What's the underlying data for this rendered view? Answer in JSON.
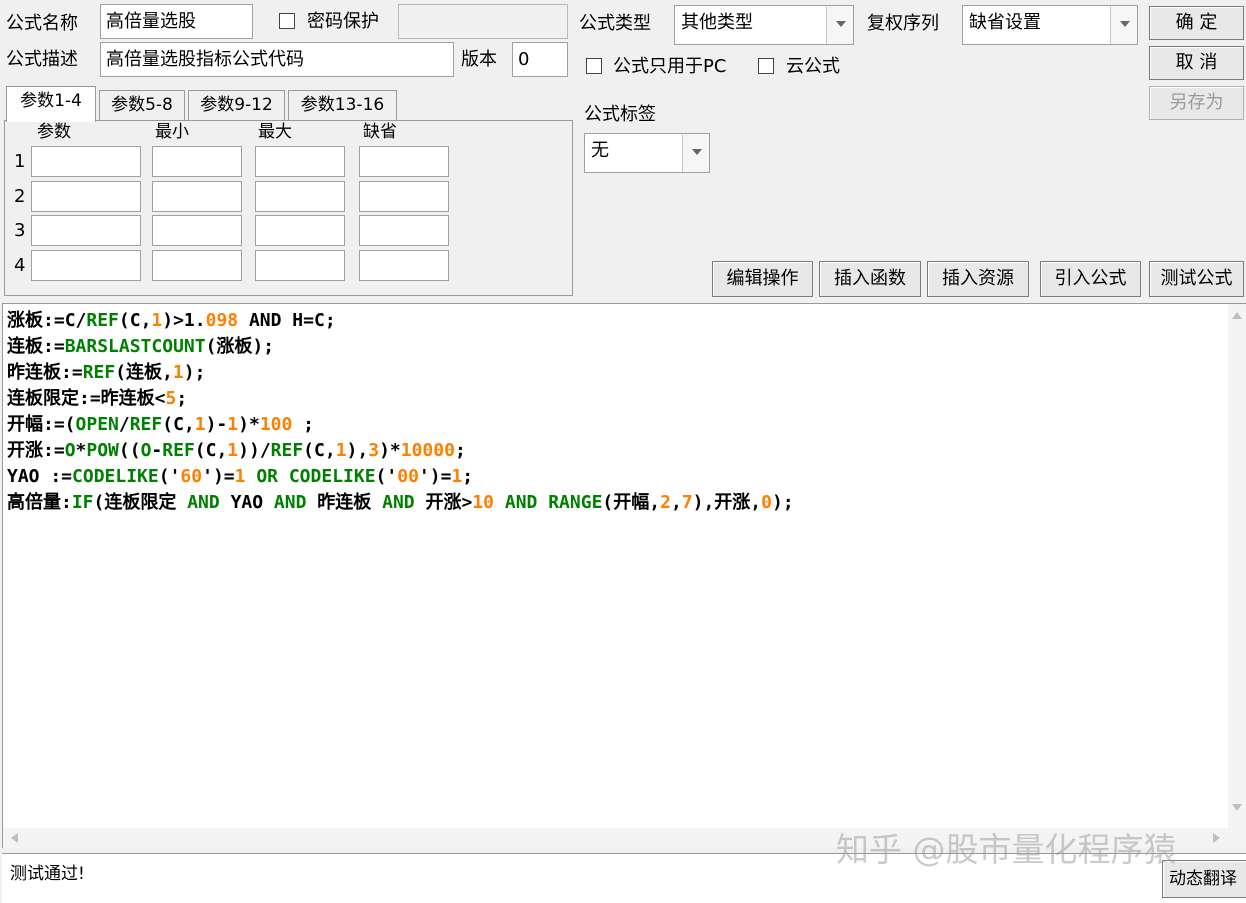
{
  "header": {
    "formula_name_label": "公式名称",
    "formula_name_value": "高倍量选股",
    "password_label": "密码保护",
    "password_checked": false,
    "password_value": "",
    "formula_desc_label": "公式描述",
    "formula_desc_value": "高倍量选股指标公式代码",
    "version_label": "版本",
    "version_value": "0",
    "formula_type_label": "公式类型",
    "formula_type_value": "其他类型",
    "rights_label": "复权序列",
    "rights_value": "缺省设置",
    "pc_only_label": "公式只用于PC",
    "pc_only_checked": false,
    "cloud_label": "云公式",
    "cloud_checked": false,
    "tag_label": "公式标签",
    "tag_value": "无"
  },
  "buttons": {
    "ok": "确 定",
    "cancel": "取 消",
    "save_as": "另存为",
    "edit_ops": "编辑操作",
    "insert_func": "插入函数",
    "insert_res": "插入资源",
    "import_formula": "引入公式",
    "test_formula": "测试公式"
  },
  "tabs": [
    "参数1-4",
    "参数5-8",
    "参数9-12",
    "参数13-16"
  ],
  "active_tab": 0,
  "params": {
    "columns": [
      "参数",
      "最小",
      "最大",
      "缺省"
    ],
    "rows": [
      "1",
      "2",
      "3",
      "4"
    ]
  },
  "code_colors": {
    "default": "#000000",
    "function": "#008000",
    "number": "#ff8000",
    "operator": "#000080"
  },
  "code_lines": [
    [
      [
        "涨板:=",
        "default"
      ],
      [
        "C/",
        "default"
      ],
      [
        "REF",
        "function"
      ],
      [
        "(C,",
        "default"
      ],
      [
        "1",
        "number"
      ],
      [
        ")>1.",
        "default"
      ],
      [
        "098",
        "number"
      ],
      [
        " AND H=C;",
        "default"
      ]
    ],
    [
      [
        "连板:=",
        "default"
      ],
      [
        "BARSLASTCOUNT",
        "function"
      ],
      [
        "(涨板);",
        "default"
      ]
    ],
    [
      [
        "昨连板:=",
        "default"
      ],
      [
        "REF",
        "function"
      ],
      [
        "(连板,",
        "default"
      ],
      [
        "1",
        "number"
      ],
      [
        ");",
        "default"
      ]
    ],
    [
      [
        "连板限定:=昨连板<",
        "default"
      ],
      [
        "5",
        "number"
      ],
      [
        ";",
        "default"
      ]
    ],
    [
      [
        "开幅:=(",
        "default"
      ],
      [
        "OPEN",
        "function"
      ],
      [
        "/",
        "default"
      ],
      [
        "REF",
        "function"
      ],
      [
        "(C,",
        "default"
      ],
      [
        "1",
        "number"
      ],
      [
        ")-",
        "default"
      ],
      [
        "1",
        "number"
      ],
      [
        ")*",
        "default"
      ],
      [
        "100",
        "number"
      ],
      [
        " ;",
        "default"
      ]
    ],
    [
      [
        "开涨:=",
        "default"
      ],
      [
        "O",
        "function"
      ],
      [
        "*",
        "default"
      ],
      [
        "POW",
        "function"
      ],
      [
        "((",
        "default"
      ],
      [
        "O",
        "function"
      ],
      [
        "-",
        "default"
      ],
      [
        "REF",
        "function"
      ],
      [
        "(C,",
        "default"
      ],
      [
        "1",
        "number"
      ],
      [
        "))/",
        "default"
      ],
      [
        "REF",
        "function"
      ],
      [
        "(C,",
        "default"
      ],
      [
        "1",
        "number"
      ],
      [
        "),",
        "default"
      ],
      [
        "3",
        "number"
      ],
      [
        ")*",
        "default"
      ],
      [
        "10000",
        "number"
      ],
      [
        ";",
        "default"
      ]
    ],
    [
      [
        "YAO :=",
        "default"
      ],
      [
        "CODELIKE",
        "function"
      ],
      [
        "('",
        "default"
      ],
      [
        "60",
        "number"
      ],
      [
        "')=",
        "default"
      ],
      [
        "1",
        "number"
      ],
      [
        " ",
        "default"
      ],
      [
        "OR",
        "function"
      ],
      [
        " ",
        "default"
      ],
      [
        "CODELIKE",
        "function"
      ],
      [
        "('",
        "default"
      ],
      [
        "00",
        "number"
      ],
      [
        "')=",
        "default"
      ],
      [
        "1",
        "number"
      ],
      [
        ";",
        "default"
      ]
    ],
    [
      [
        "高倍量:",
        "default"
      ],
      [
        "IF",
        "function"
      ],
      [
        "(连板限定 ",
        "default"
      ],
      [
        "AND",
        "function"
      ],
      [
        " YAO ",
        "default"
      ],
      [
        "AND",
        "function"
      ],
      [
        " 昨连板 ",
        "default"
      ],
      [
        "AND",
        "function"
      ],
      [
        " 开涨>",
        "default"
      ],
      [
        "10",
        "number"
      ],
      [
        " ",
        "default"
      ],
      [
        "AND",
        "function"
      ],
      [
        " ",
        "default"
      ],
      [
        "RANGE",
        "function"
      ],
      [
        "(开幅,",
        "default"
      ],
      [
        "2",
        "number"
      ],
      [
        ",",
        "default"
      ],
      [
        "7",
        "number"
      ],
      [
        "),开涨,",
        "default"
      ],
      [
        "0",
        "number"
      ],
      [
        ");",
        "default"
      ]
    ]
  ],
  "status": {
    "message": "测试通过!",
    "translate_button": "动态翻译"
  },
  "watermark": "知乎 @股市量化程序猿"
}
